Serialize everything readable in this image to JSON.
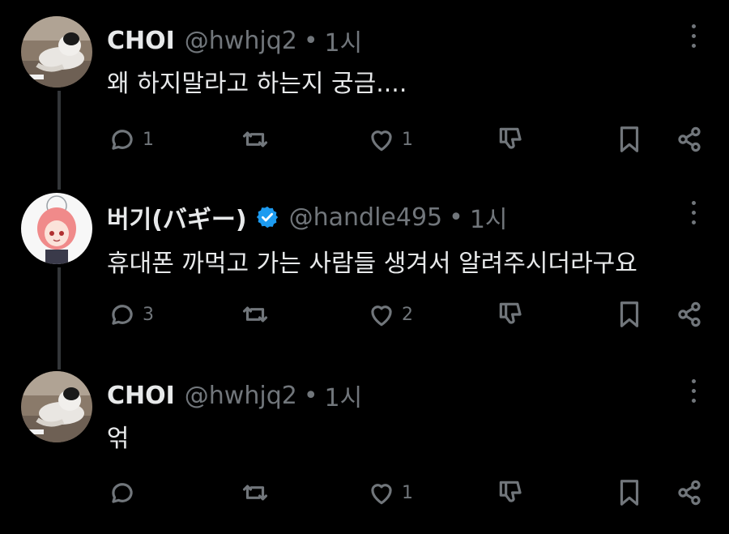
{
  "posts": [
    {
      "author": "CHOI",
      "handle": "@hwhjq2",
      "separator": "•",
      "time": "1시",
      "text": "왜 하지말라고 하는지 궁금....",
      "verified": false,
      "avatar": "dog-photo-avatar",
      "counts": {
        "reply": "1",
        "repost": "",
        "like": "1"
      }
    },
    {
      "author": "버기(バギー)",
      "handle": "@handle495",
      "separator": "•",
      "time": "1시",
      "text": "휴대폰 까먹고 가는 사람들 생겨서 알려주시더라구요",
      "verified": true,
      "avatar": "anime-character-avatar",
      "counts": {
        "reply": "3",
        "repost": "",
        "like": "2"
      }
    },
    {
      "author": "CHOI",
      "handle": "@hwhjq2",
      "separator": "•",
      "time": "1시",
      "text": "얶",
      "verified": false,
      "avatar": "dog-photo-avatar",
      "counts": {
        "reply": "",
        "repost": "",
        "like": "1"
      }
    }
  ],
  "colors": {
    "background": "#000000",
    "text": "#e7e9ea",
    "muted": "#71767b",
    "verified": "#1d9bf0"
  },
  "icons": [
    "reply-icon",
    "repost-icon",
    "like-icon",
    "dislike-icon",
    "bookmark-icon",
    "share-icon",
    "more-icon",
    "verified-badge-icon"
  ]
}
